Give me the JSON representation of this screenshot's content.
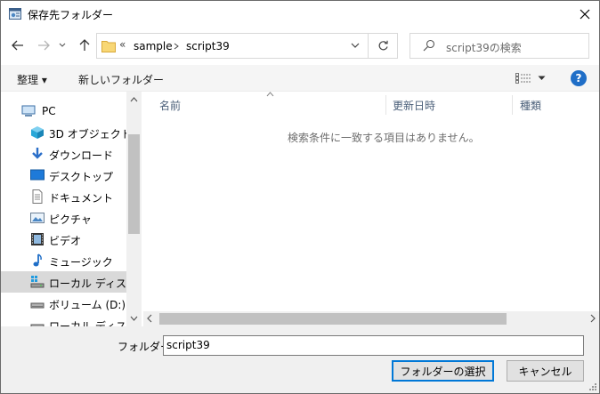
{
  "window": {
    "title": "保存先フォルダー"
  },
  "address": {
    "overflow": "«",
    "crumbs": [
      "sample",
      "script39"
    ]
  },
  "search": {
    "placeholder": "script39の検索"
  },
  "toolbar": {
    "organize": "整理 ▾",
    "new_folder": "新しいフォルダー",
    "help": "?"
  },
  "nav": {
    "items": [
      {
        "label": "PC",
        "icon": "pc-icon"
      },
      {
        "label": "3D オブジェクト",
        "icon": "3d-objects-icon"
      },
      {
        "label": "ダウンロード",
        "icon": "download-icon"
      },
      {
        "label": "デスクトップ",
        "icon": "desktop-icon"
      },
      {
        "label": "ドキュメント",
        "icon": "document-icon"
      },
      {
        "label": "ピクチャ",
        "icon": "pictures-icon"
      },
      {
        "label": "ビデオ",
        "icon": "video-icon"
      },
      {
        "label": "ミュージック",
        "icon": "music-icon"
      },
      {
        "label": "ローカル ディスク (C",
        "icon": "local-disk-icon"
      },
      {
        "label": "ボリューム (D:)",
        "icon": "drive-icon"
      },
      {
        "label": "ローカル ディスク (E",
        "icon": "drive-icon"
      }
    ]
  },
  "columns": {
    "name": "名前",
    "modified": "更新日時",
    "type": "種類"
  },
  "empty_message": "検索条件に一致する項目はありません。",
  "bottom": {
    "folder_label": "フォルダー:",
    "folder_value": "script39",
    "select_button": "フォルダーの選択",
    "cancel_button": "キャンセル"
  },
  "colors": {
    "accent": "#0078d7",
    "help_blue": "#1f6ec7",
    "selection": "#d9d9d9",
    "header_text": "#4c607a"
  }
}
